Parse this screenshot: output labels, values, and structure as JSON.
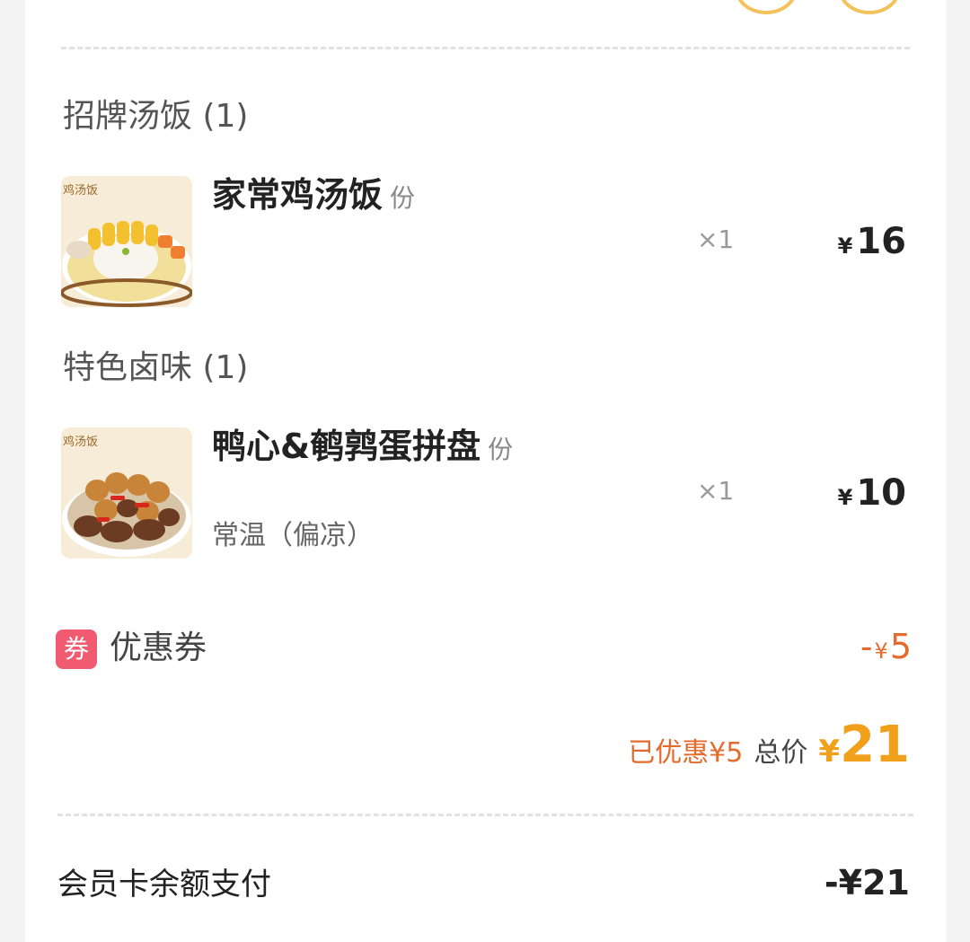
{
  "categories": [
    {
      "title": "招牌汤饭 (1)",
      "items": [
        {
          "name": "家常鸡汤饭",
          "unit": "份",
          "qty": "×1",
          "price_symbol": "¥",
          "price": "16",
          "spec": "",
          "image_label": "鸡汤饭"
        }
      ]
    },
    {
      "title": "特色卤味 (1)",
      "items": [
        {
          "name": "鸭心&鹌鹑蛋拼盘",
          "unit": "份",
          "qty": "×1",
          "price_symbol": "¥",
          "price": "10",
          "spec": "常温（偏凉）",
          "image_label": "鸡汤饭"
        }
      ]
    }
  ],
  "coupon": {
    "icon_text": "券",
    "label": "优惠券",
    "minus": "-",
    "symbol": "¥",
    "value": "5"
  },
  "summary": {
    "saved": "已优惠¥5",
    "total_label": "总价",
    "total_symbol": "¥",
    "total_value": "21"
  },
  "payment": {
    "label": "会员卡余额支付",
    "value": "-¥21"
  },
  "colors": {
    "accent_orange": "#e46b2d",
    "total_gold": "#f0a01a",
    "coupon_pink": "#f05b72"
  }
}
